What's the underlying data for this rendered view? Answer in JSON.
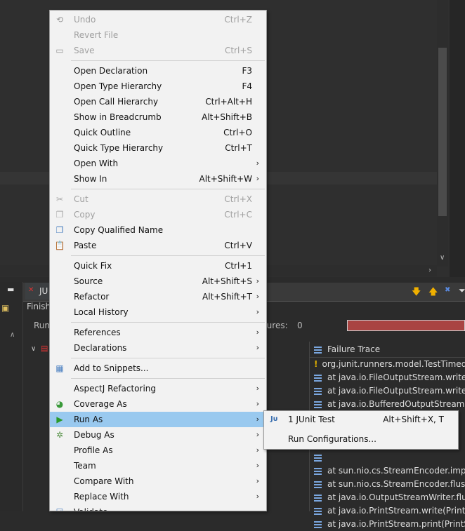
{
  "context_menu": {
    "items": [
      {
        "label": "Undo",
        "shortcut": "Ctrl+Z",
        "disabled": true,
        "icon": "undo-icon",
        "submenu": false
      },
      {
        "label": "Revert File",
        "shortcut": "",
        "disabled": true,
        "icon": "",
        "submenu": false
      },
      {
        "label": "Save",
        "shortcut": "Ctrl+S",
        "disabled": true,
        "icon": "save-icon",
        "submenu": false
      },
      {
        "sep": true
      },
      {
        "label": "Open Declaration",
        "shortcut": "F3",
        "disabled": false,
        "icon": "",
        "submenu": false
      },
      {
        "label": "Open Type Hierarchy",
        "shortcut": "F4",
        "disabled": false,
        "icon": "",
        "submenu": false
      },
      {
        "label": "Open Call Hierarchy",
        "shortcut": "Ctrl+Alt+H",
        "disabled": false,
        "icon": "",
        "submenu": false
      },
      {
        "label": "Show in Breadcrumb",
        "shortcut": "Alt+Shift+B",
        "disabled": false,
        "icon": "",
        "submenu": false
      },
      {
        "label": "Quick Outline",
        "shortcut": "Ctrl+O",
        "disabled": false,
        "icon": "",
        "submenu": false
      },
      {
        "label": "Quick Type Hierarchy",
        "shortcut": "Ctrl+T",
        "disabled": false,
        "icon": "",
        "submenu": false
      },
      {
        "label": "Open With",
        "shortcut": "",
        "disabled": false,
        "icon": "",
        "submenu": true
      },
      {
        "label": "Show In",
        "shortcut": "Alt+Shift+W",
        "disabled": false,
        "icon": "",
        "submenu": true
      },
      {
        "sep": true
      },
      {
        "label": "Cut",
        "shortcut": "Ctrl+X",
        "disabled": true,
        "icon": "cut-icon",
        "submenu": false
      },
      {
        "label": "Copy",
        "shortcut": "Ctrl+C",
        "disabled": true,
        "icon": "copy-icon",
        "submenu": false
      },
      {
        "label": "Copy Qualified Name",
        "shortcut": "",
        "disabled": false,
        "icon": "copy-qualified-icon",
        "submenu": false
      },
      {
        "label": "Paste",
        "shortcut": "Ctrl+V",
        "disabled": false,
        "icon": "paste-icon",
        "submenu": false
      },
      {
        "sep": true
      },
      {
        "label": "Quick Fix",
        "shortcut": "Ctrl+1",
        "disabled": false,
        "icon": "",
        "submenu": false
      },
      {
        "label": "Source",
        "shortcut": "Alt+Shift+S",
        "disabled": false,
        "icon": "",
        "submenu": true
      },
      {
        "label": "Refactor",
        "shortcut": "Alt+Shift+T",
        "disabled": false,
        "icon": "",
        "submenu": true
      },
      {
        "label": "Local History",
        "shortcut": "",
        "disabled": false,
        "icon": "",
        "submenu": true
      },
      {
        "sep": true
      },
      {
        "label": "References",
        "shortcut": "",
        "disabled": false,
        "icon": "",
        "submenu": true
      },
      {
        "label": "Declarations",
        "shortcut": "",
        "disabled": false,
        "icon": "",
        "submenu": true
      },
      {
        "sep": true
      },
      {
        "label": "Add to Snippets...",
        "shortcut": "",
        "disabled": false,
        "icon": "snippets-icon",
        "submenu": false
      },
      {
        "sep": true
      },
      {
        "label": "AspectJ Refactoring",
        "shortcut": "",
        "disabled": false,
        "icon": "",
        "submenu": true
      },
      {
        "label": "Coverage As",
        "shortcut": "",
        "disabled": false,
        "icon": "coverage-icon",
        "submenu": true
      },
      {
        "label": "Run As",
        "shortcut": "",
        "disabled": false,
        "icon": "run-icon",
        "submenu": true,
        "selected": true
      },
      {
        "label": "Debug As",
        "shortcut": "",
        "disabled": false,
        "icon": "debug-icon",
        "submenu": true
      },
      {
        "label": "Profile As",
        "shortcut": "",
        "disabled": false,
        "icon": "",
        "submenu": true
      },
      {
        "label": "Team",
        "shortcut": "",
        "disabled": false,
        "icon": "",
        "submenu": true
      },
      {
        "label": "Compare With",
        "shortcut": "",
        "disabled": false,
        "icon": "",
        "submenu": true
      },
      {
        "label": "Replace With",
        "shortcut": "",
        "disabled": false,
        "icon": "",
        "submenu": true
      },
      {
        "label": "Validate",
        "shortcut": "",
        "disabled": false,
        "icon": "validate-icon",
        "submenu": false
      }
    ]
  },
  "run_as_submenu": {
    "items": [
      {
        "label": "1 JUnit Test",
        "shortcut": "Alt+Shift+X, T",
        "icon": "junit-icon"
      },
      {
        "label": "Run Configurations...",
        "shortcut": "",
        "icon": ""
      }
    ]
  },
  "junit_view": {
    "tab_label": "JU",
    "status": "Finish",
    "runs_label": "Run",
    "failures_label": "ilures:",
    "failures_value": "0",
    "failure_bar_color": "#a94442"
  },
  "failure_trace": {
    "header": "Failure Trace",
    "rows": [
      "org.junit.runners.model.TestTimedOut",
      "at java.io.FileOutputStream.writeBytes",
      "at java.io.FileOutputStream.write(File",
      "at java.io.BufferedOutputStream.flush",
      "",
      "",
      "",
      "",
      "at sun.nio.cs.StreamEncoder.implFlus",
      "at sun.nio.cs.StreamEncoder.flushBuf",
      "at java.io.OutputStreamWriter.flushB",
      "at java.io.PrintStream.write(PrintStrea",
      "at java.io.PrintStream.print(PrintStre"
    ]
  }
}
